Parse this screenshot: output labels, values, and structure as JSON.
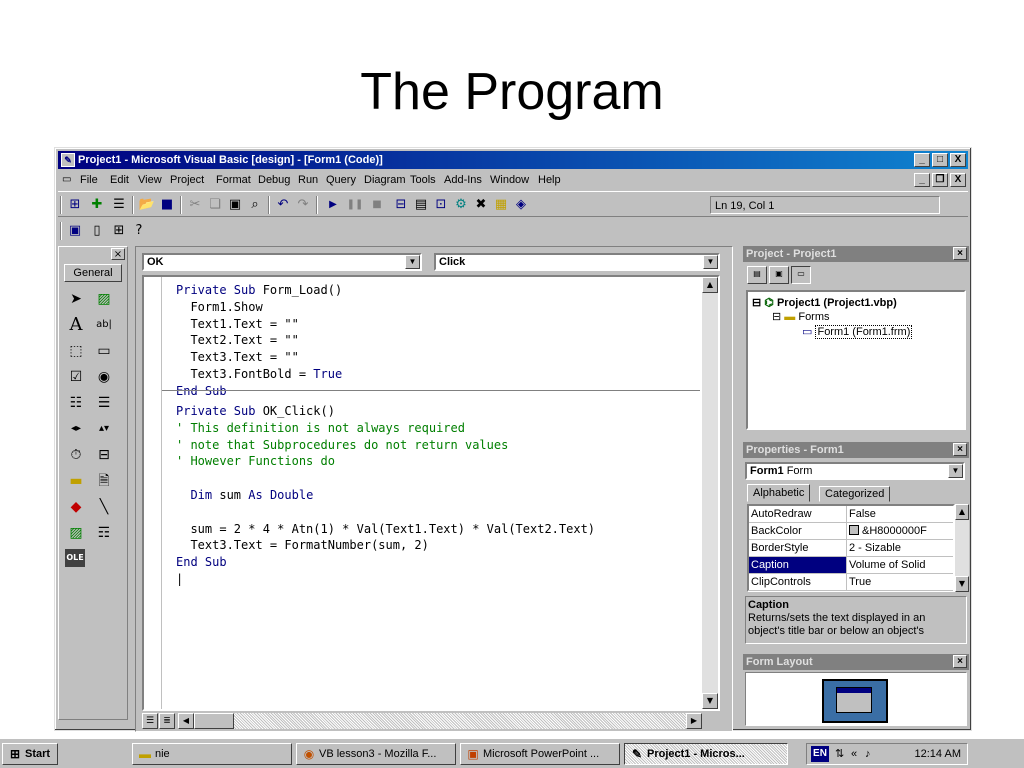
{
  "slide": {
    "title": "The Program"
  },
  "window": {
    "title": "Project1 - Microsoft Visual Basic [design] - [Form1 (Code)]",
    "caption_buttons": [
      "_",
      "□",
      "X"
    ],
    "mdi_buttons": [
      "_",
      "̅̅",
      "X"
    ]
  },
  "menu": [
    "File",
    "Edit",
    "View",
    "Project",
    "Format",
    "Debug",
    "Run",
    "Query",
    "Diagram",
    "Tools",
    "Add-Ins",
    "Window",
    "Help"
  ],
  "statusbar": {
    "position": "Ln 19, Col 1"
  },
  "toolbox": {
    "tab": "General"
  },
  "code": {
    "object_combo": "OK",
    "procedure_combo": "Click",
    "block1": [
      [
        [
          "kw",
          "Private Sub "
        ],
        [
          "t",
          "Form_Load()"
        ]
      ],
      [
        [
          "t",
          "  Form1.Show"
        ]
      ],
      [
        [
          "t",
          "  Text1.Text = \"\""
        ]
      ],
      [
        [
          "t",
          "  Text2.Text = \"\""
        ]
      ],
      [
        [
          "t",
          "  Text3.Text = \"\""
        ]
      ],
      [
        [
          "t",
          "  Text3.FontBold = "
        ],
        [
          "kw",
          "True"
        ]
      ],
      [
        [
          "kw",
          "End Sub"
        ]
      ]
    ],
    "block2": [
      [
        [
          "kw",
          "Private Sub "
        ],
        [
          "t",
          "OK_Click()"
        ]
      ],
      [
        [
          "cm",
          "' This definition is not always required"
        ]
      ],
      [
        [
          "cm",
          "' note that Subprocedures do not return values"
        ]
      ],
      [
        [
          "cm",
          "' However Functions do"
        ]
      ],
      [
        [
          "t",
          ""
        ]
      ],
      [
        [
          "t",
          "  "
        ],
        [
          "kw",
          "Dim "
        ],
        [
          "t",
          "sum "
        ],
        [
          "kw",
          "As Double"
        ]
      ],
      [
        [
          "t",
          ""
        ]
      ],
      [
        [
          "t",
          "  sum = 2 * 4 * Atn(1) * Val(Text1.Text) * Val(Text2.Text)"
        ]
      ],
      [
        [
          "t",
          "  Text3.Text = FormatNumber(sum, 2)"
        ]
      ],
      [
        [
          "kw",
          "End Sub"
        ]
      ],
      [
        [
          "t",
          "|"
        ]
      ]
    ]
  },
  "project_panel": {
    "title": "Project - Project1",
    "root": "Project1 (Project1.vbp)",
    "folder": "Forms",
    "form": "Form1 (Form1.frm)"
  },
  "properties_panel": {
    "title": "Properties - Form1",
    "object_bold": "Form1",
    "object_type": "Form",
    "tabs": [
      "Alphabetic",
      "Categorized"
    ],
    "rows": [
      {
        "name": "AutoRedraw",
        "value": "False"
      },
      {
        "name": "BackColor",
        "value": "&H8000000F"
      },
      {
        "name": "BorderStyle",
        "value": "2 - Sizable"
      },
      {
        "name": "Caption",
        "value": "Volume of Solid"
      },
      {
        "name": "ClipControls",
        "value": "True"
      }
    ],
    "desc_title": "Caption",
    "desc_text": "Returns/sets the text displayed in an object's title bar or below an object's"
  },
  "layout_panel": {
    "title": "Form Layout"
  },
  "taskbar": {
    "start": "Start",
    "tasks": [
      "nie",
      "VB lesson3 - Mozilla F...",
      "Microsoft PowerPoint ...",
      "Project1 - Micros..."
    ],
    "lang": "EN",
    "clock": "12:14 AM"
  },
  "colors": {
    "title_active": "#000080",
    "title_inactive": "#808080",
    "keyword": "#00007f",
    "comment": "#007f00",
    "selection": "#000080"
  }
}
